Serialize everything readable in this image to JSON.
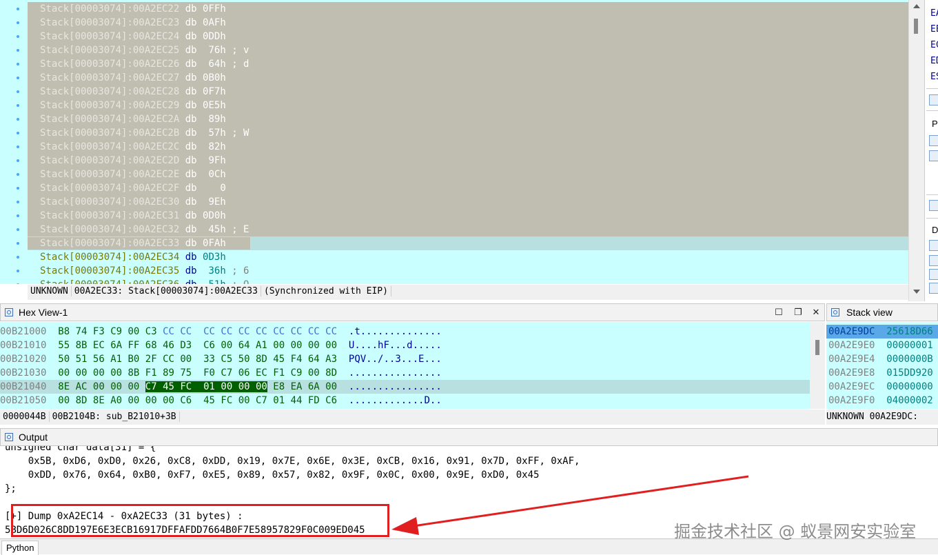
{
  "disasm": {
    "lines": [
      {
        "seg": "Stack[00003074]:00A2EC22",
        "op": "db",
        "val": "0FFh",
        "cmt": "",
        "selected": true
      },
      {
        "seg": "Stack[00003074]:00A2EC23",
        "op": "db",
        "val": "0AFh",
        "cmt": "",
        "selected": true
      },
      {
        "seg": "Stack[00003074]:00A2EC24",
        "op": "db",
        "val": "0DDh",
        "cmt": "",
        "selected": true
      },
      {
        "seg": "Stack[00003074]:00A2EC25",
        "op": "db",
        "val": " 76h",
        "cmt": "; v",
        "selected": true
      },
      {
        "seg": "Stack[00003074]:00A2EC26",
        "op": "db",
        "val": " 64h",
        "cmt": "; d",
        "selected": true
      },
      {
        "seg": "Stack[00003074]:00A2EC27",
        "op": "db",
        "val": "0B0h",
        "cmt": "",
        "selected": true
      },
      {
        "seg": "Stack[00003074]:00A2EC28",
        "op": "db",
        "val": "0F7h",
        "cmt": "",
        "selected": true
      },
      {
        "seg": "Stack[00003074]:00A2EC29",
        "op": "db",
        "val": "0E5h",
        "cmt": "",
        "selected": true
      },
      {
        "seg": "Stack[00003074]:00A2EC2A",
        "op": "db",
        "val": " 89h",
        "cmt": "",
        "selected": true
      },
      {
        "seg": "Stack[00003074]:00A2EC2B",
        "op": "db",
        "val": " 57h",
        "cmt": "; W",
        "selected": true
      },
      {
        "seg": "Stack[00003074]:00A2EC2C",
        "op": "db",
        "val": " 82h",
        "cmt": "",
        "selected": true
      },
      {
        "seg": "Stack[00003074]:00A2EC2D",
        "op": "db",
        "val": " 9Fh",
        "cmt": "",
        "selected": true
      },
      {
        "seg": "Stack[00003074]:00A2EC2E",
        "op": "db",
        "val": " 0Ch",
        "cmt": "",
        "selected": true
      },
      {
        "seg": "Stack[00003074]:00A2EC2F",
        "op": "db",
        "val": "   0",
        "cmt": "",
        "selected": true
      },
      {
        "seg": "Stack[00003074]:00A2EC30",
        "op": "db",
        "val": " 9Eh",
        "cmt": "",
        "selected": true
      },
      {
        "seg": "Stack[00003074]:00A2EC31",
        "op": "db",
        "val": "0D0h",
        "cmt": "",
        "selected": true
      },
      {
        "seg": "Stack[00003074]:00A2EC32",
        "op": "db",
        "val": " 45h",
        "cmt": "; E",
        "selected": true
      },
      {
        "seg": "Stack[00003074]:00A2EC33",
        "op": "db",
        "val": "0FAh",
        "cmt": "",
        "selected": true
      },
      {
        "seg": "Stack[00003074]:00A2EC34",
        "op": "db",
        "val": "0D3h",
        "cmt": "",
        "selected": false
      },
      {
        "seg": "Stack[00003074]:00A2EC35",
        "op": "db",
        "val": " 36h",
        "cmt": "; 6",
        "selected": false
      },
      {
        "seg": "Stack[00003074]:00A2EC36",
        "op": "db",
        "val": " 51h",
        "cmt": "; Q",
        "selected": false
      }
    ],
    "status": {
      "mode": "UNKNOWN",
      "addr": "00A2EC33: Stack[00003074]:00A2EC33",
      "sync": "(Synchronized with EIP)"
    }
  },
  "registers": [
    "EA",
    "EE",
    "EC",
    "ED",
    "ES"
  ],
  "right_labels": {
    "p": "P",
    "d": "D"
  },
  "hex": {
    "title": "Hex View-1",
    "rows": [
      {
        "addr": "00B21000",
        "bytes": [
          "B8",
          "74",
          "F3",
          "C9",
          "00",
          "C3",
          "CC",
          "CC",
          "CC",
          "CC",
          "CC",
          "CC",
          "CC",
          "CC",
          "CC",
          "CC"
        ],
        "ascii": ".t.............."
      },
      {
        "addr": "00B21010",
        "bytes": [
          "55",
          "8B",
          "EC",
          "6A",
          "FF",
          "68",
          "46",
          "D3",
          "C6",
          "00",
          "64",
          "A1",
          "00",
          "00",
          "00",
          "00"
        ],
        "ascii": "U....hF...d....."
      },
      {
        "addr": "00B21020",
        "bytes": [
          "50",
          "51",
          "56",
          "A1",
          "B0",
          "2F",
          "CC",
          "00",
          "33",
          "C5",
          "50",
          "8D",
          "45",
          "F4",
          "64",
          "A3"
        ],
        "ascii": "PQV../..3...E..."
      },
      {
        "addr": "00B21030",
        "bytes": [
          "00",
          "00",
          "00",
          "00",
          "8B",
          "F1",
          "89",
          "75",
          "F0",
          "C7",
          "06",
          "EC",
          "F1",
          "C9",
          "00",
          "8D"
        ],
        "ascii": "................"
      },
      {
        "addr": "00B21040",
        "bytes": [
          "8E",
          "AC",
          "00",
          "00",
          "00",
          "C7",
          "45",
          "FC",
          "01",
          "00",
          "00",
          "00",
          "E8",
          "EA",
          "6A",
          "00"
        ],
        "ascii": "................"
      },
      {
        "addr": "00B21050",
        "bytes": [
          "00",
          "8D",
          "8E",
          "A0",
          "00",
          "00",
          "00",
          "C6",
          "45",
          "FC",
          "00",
          "C7",
          "01",
          "44",
          "FD",
          "C6"
        ],
        "ascii": ".............D.."
      }
    ],
    "status": {
      "offset": "0000044B",
      "location": "00B2104B: sub_B21010+3B"
    }
  },
  "stack": {
    "title": "Stack view",
    "rows": [
      {
        "addr": "00A2E9DC",
        "val": "25618D66"
      },
      {
        "addr": "00A2E9E0",
        "val": "00000001"
      },
      {
        "addr": "00A2E9E4",
        "val": "0000000B"
      },
      {
        "addr": "00A2E9E8",
        "val": "015DD920"
      },
      {
        "addr": "00A2E9EC",
        "val": "00000000"
      },
      {
        "addr": "00A2E9F0",
        "val": "04000002"
      }
    ],
    "status": "UNKNOWN 00A2E9DC:"
  },
  "output": {
    "title": "Output",
    "lines": [
      "unsigned char data[31] = {",
      "    0x5B, 0xD6, 0xD0, 0x26, 0xC8, 0xDD, 0x19, 0x7E, 0x6E, 0x3E, 0xCB, 0x16, 0x91, 0x7D, 0xFF, 0xAF,",
      "    0xDD, 0x76, 0x64, 0xB0, 0xF7, 0xE5, 0x89, 0x57, 0x82, 0x9F, 0x0C, 0x00, 0x9E, 0xD0, 0x45",
      "};",
      "",
      "[+] Dump 0xA2EC14 - 0xA2EC33 (31 bytes) :",
      "5BD6D026C8DD197E6E3ECB16917DFFAFDD7664B0F7E58957829F0C009ED045"
    ],
    "tab": "Python"
  },
  "watermark": "掘金技术社区 @ 蚁景网安实验室",
  "colors": {
    "annotation": "#e02020",
    "selection": "#c0bdb1",
    "background": "#c9ffff"
  }
}
